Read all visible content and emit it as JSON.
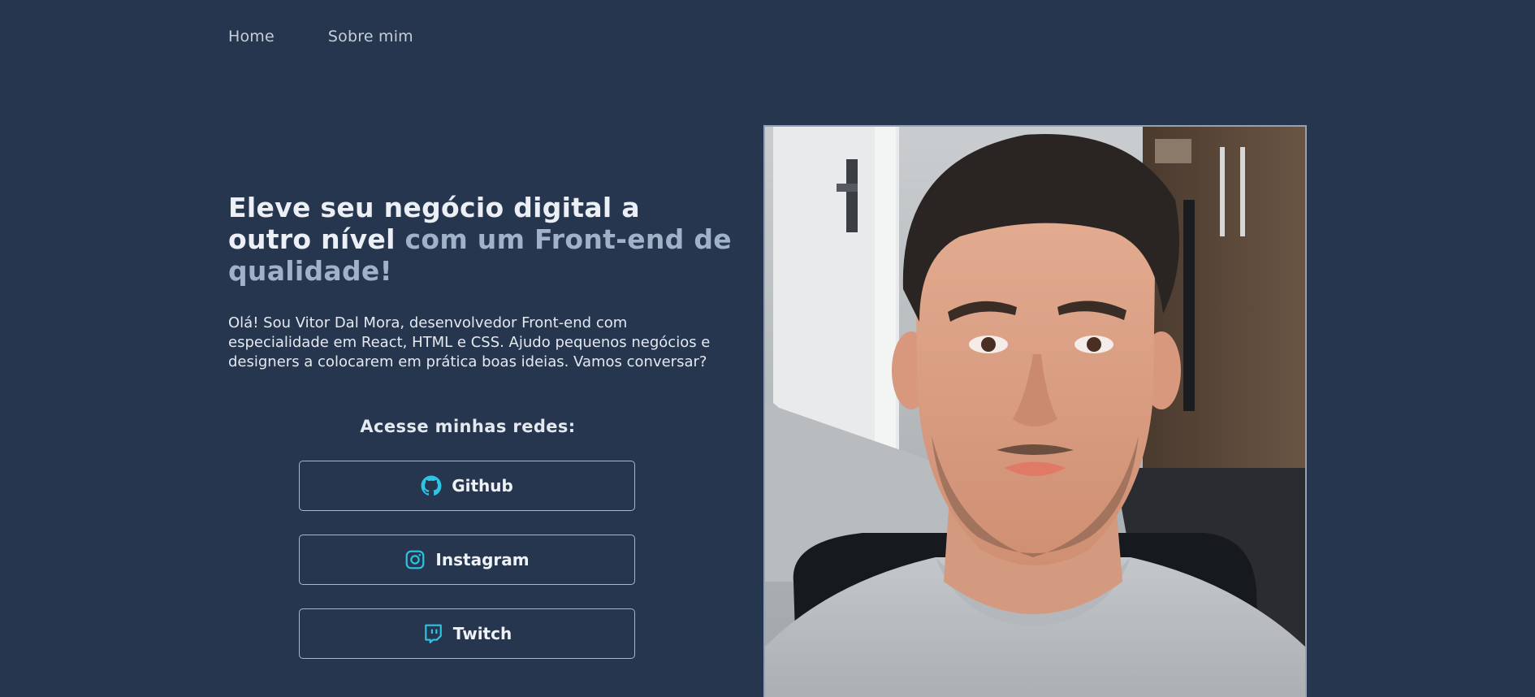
{
  "nav": {
    "home_label": "Home",
    "about_label": "Sobre mim"
  },
  "hero": {
    "title_part1": "Eleve seu negócio digital a outro nível",
    "title_part2": "com um Front-end de qualidade!",
    "intro": "Olá! Sou Vitor Dal Mora, desenvolvedor Front-end com especialidade em React, HTML e CSS. Ajudo pequenos negócios e designers a colocarem em prática boas ideias. Vamos conversar?"
  },
  "networks": {
    "title": "Acesse minhas redes:",
    "buttons": [
      {
        "label": "Github",
        "icon": "github-icon"
      },
      {
        "label": "Instagram",
        "icon": "instagram-icon"
      },
      {
        "label": "Twitch",
        "icon": "twitch-icon"
      }
    ]
  },
  "photo": {
    "subject": "profile-photo"
  },
  "colors": {
    "background": "#27364f",
    "accent_text": "#9fb2c8",
    "icon_accent": "#2ec4e6",
    "border": "#a8b7c9"
  }
}
